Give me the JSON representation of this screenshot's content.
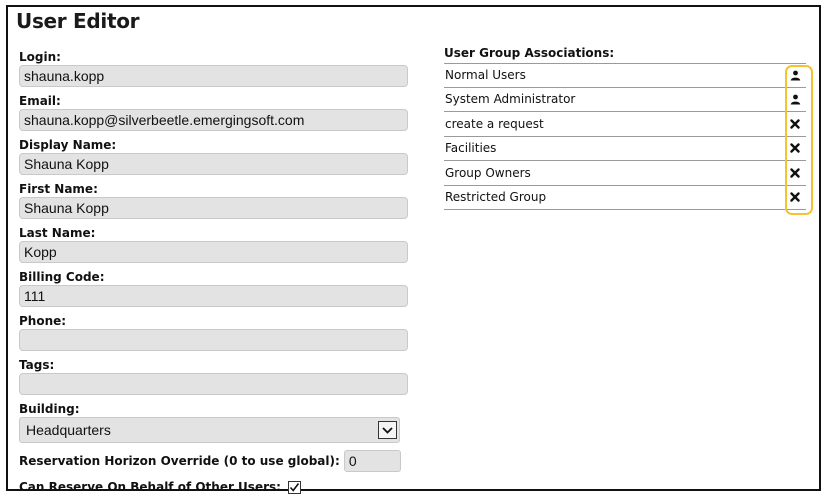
{
  "page": {
    "title": "User Editor"
  },
  "form": {
    "login": {
      "label": "Login:",
      "value": "shauna.kopp"
    },
    "email": {
      "label": "Email:",
      "value": "shauna.kopp@silverbeetle.emergingsoft.com"
    },
    "display_name": {
      "label": "Display Name:",
      "value": "Shauna Kopp"
    },
    "first_name": {
      "label": "First Name:",
      "value": "Shauna Kopp"
    },
    "last_name": {
      "label": "Last Name:",
      "value": "Kopp"
    },
    "billing_code": {
      "label": "Billing Code:",
      "value": "111"
    },
    "phone": {
      "label": "Phone:",
      "value": ""
    },
    "tags": {
      "label": "Tags:",
      "value": ""
    },
    "building": {
      "label": "Building:",
      "selected": "Headquarters"
    },
    "horizon": {
      "label": "Reservation Horizon Override (0 to use global):",
      "value": "0"
    },
    "on_behalf": {
      "label": "Can Reserve On Behalf of Other Users:",
      "checked": true
    }
  },
  "groups": {
    "heading": "User Group Associations:",
    "rows": [
      {
        "name": "Normal Users",
        "action_icon": "user-icon"
      },
      {
        "name": "System Administrator",
        "action_icon": "user-icon"
      },
      {
        "name": "create a request",
        "action_icon": "remove-icon"
      },
      {
        "name": "Facilities",
        "action_icon": "remove-icon"
      },
      {
        "name": "Group Owners",
        "action_icon": "remove-icon"
      },
      {
        "name": "Restricted Group",
        "action_icon": "remove-icon"
      }
    ]
  },
  "colors": {
    "highlight": "#f4c430",
    "input_bg": "#e3e3e3"
  }
}
